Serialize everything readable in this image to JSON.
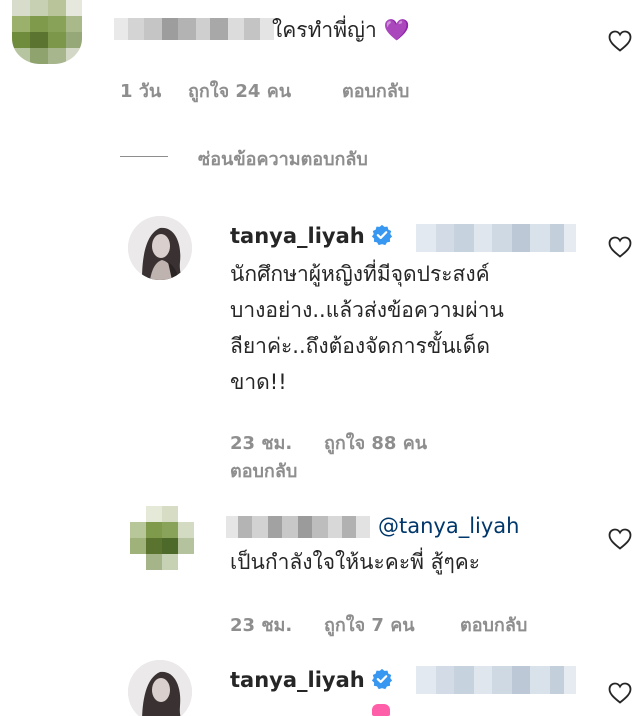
{
  "comment1": {
    "text": "ใครทำพี่ญ่า",
    "emoji": "💜",
    "time": "1 วัน",
    "likes": "ถูกใจ 24 คน",
    "reply": "ตอบกลับ"
  },
  "hide_replies_label": "ซ่อนข้อความตอบกลับ",
  "reply1": {
    "username": "tanya_liyah",
    "lines": [
      "นักศึกษาผู้หญิงที่มีจุดประสงค์",
      "บางอย่าง..แล้วส่งข้อความผ่าน",
      "ลียาค่ะ..ถึงต้องจัดการขั้นเด็ด",
      "ขาด!!"
    ],
    "time": "23 ชม.",
    "likes": "ถูกใจ 88 คน",
    "reply": "ตอบกลับ"
  },
  "reply2": {
    "mention": "@tanya_liyah",
    "text": "เป็นกำลังใจให้นะคะพี่ สู้ๆคะ",
    "time": "23 ชม.",
    "likes": "ถูกใจ 7 คน",
    "reply": "ตอบกลับ"
  },
  "reply3": {
    "username": "tanya_liyah"
  },
  "colors": {
    "text": "#262626",
    "meta": "#8e8e8e",
    "mention": "#00376b",
    "verified": "#3897f0"
  },
  "icons": [
    "heart-outline-icon",
    "verified-badge-icon",
    "purple-heart-emoji",
    "pink-heart-emoji"
  ]
}
